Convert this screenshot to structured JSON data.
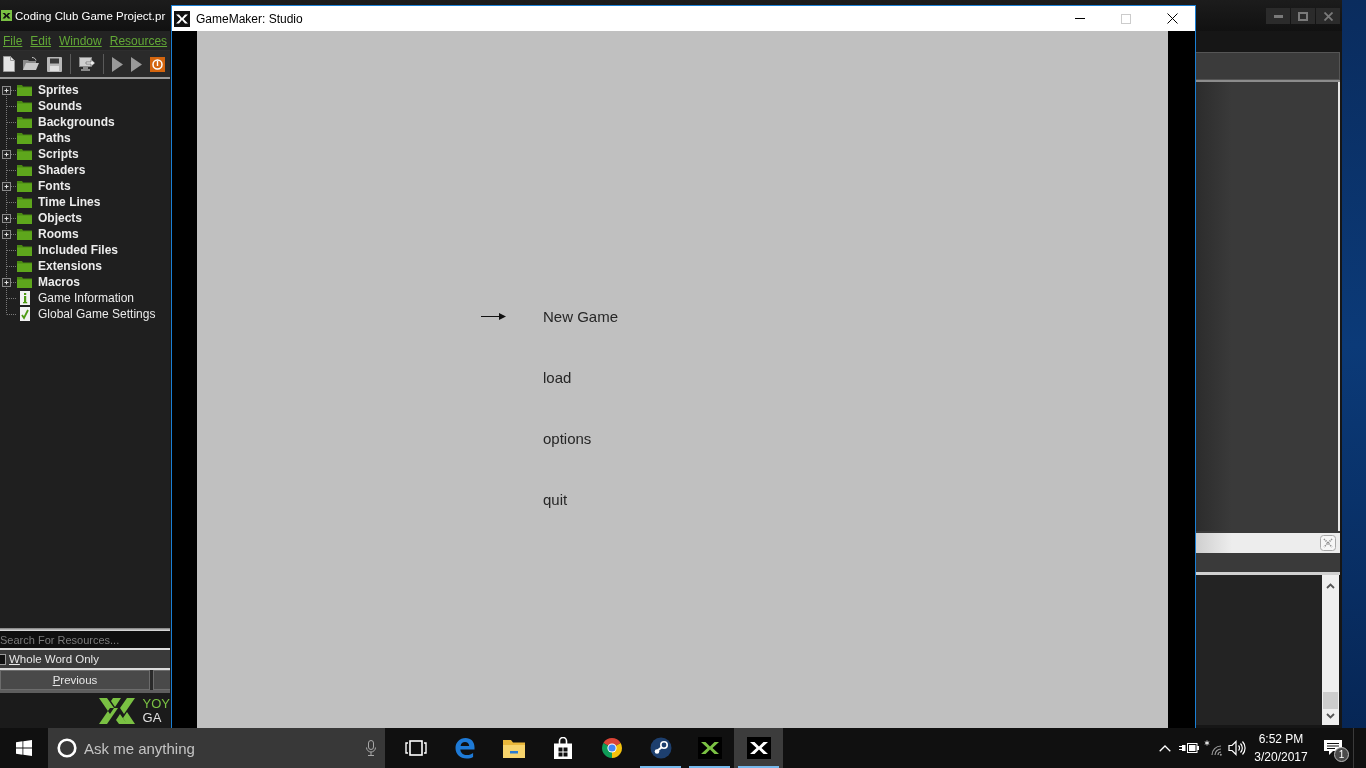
{
  "ide_window": {
    "title": "Coding Club Game Project.pr",
    "menu": [
      "File",
      "Edit",
      "Window",
      "Resources"
    ],
    "resource_tree": [
      {
        "label": "Sprites",
        "kind": "folder",
        "expandable": true
      },
      {
        "label": "Sounds",
        "kind": "folder",
        "expandable": false
      },
      {
        "label": "Backgrounds",
        "kind": "folder",
        "expandable": false
      },
      {
        "label": "Paths",
        "kind": "folder",
        "expandable": false
      },
      {
        "label": "Scripts",
        "kind": "folder",
        "expandable": true
      },
      {
        "label": "Shaders",
        "kind": "folder",
        "expandable": false
      },
      {
        "label": "Fonts",
        "kind": "folder",
        "expandable": true
      },
      {
        "label": "Time Lines",
        "kind": "folder",
        "expandable": false
      },
      {
        "label": "Objects",
        "kind": "folder",
        "expandable": true
      },
      {
        "label": "Rooms",
        "kind": "folder",
        "expandable": true
      },
      {
        "label": "Included Files",
        "kind": "folder",
        "expandable": false
      },
      {
        "label": "Extensions",
        "kind": "folder",
        "expandable": false
      },
      {
        "label": "Macros",
        "kind": "folder",
        "expandable": true
      },
      {
        "label": "Game Information",
        "kind": "info",
        "expandable": false
      },
      {
        "label": "Global Game Settings",
        "kind": "settings",
        "expandable": false
      }
    ],
    "search": {
      "placeholder": "Search For Resources..."
    },
    "whole_word_only": {
      "label": "Whole Word Only",
      "checked": false
    },
    "buttons": [
      "Previous"
    ],
    "logo": {
      "line_1": "YOY",
      "line_2": "GA"
    }
  },
  "game_window": {
    "title": "GameMaker: Studio",
    "maximize_disabled": true,
    "menu": [
      {
        "label": "New Game",
        "selected": true
      },
      {
        "label": "load",
        "selected": false
      },
      {
        "label": "options",
        "selected": false
      },
      {
        "label": "quit",
        "selected": false
      }
    ]
  },
  "taskbar": {
    "search": {
      "placeholder": "Ask me anything"
    },
    "apps": [
      {
        "kind": "task_view",
        "running": false,
        "active": false
      },
      {
        "kind": "e_logo",
        "running": false,
        "active": false
      },
      {
        "kind": "folder",
        "running": false,
        "active": false
      },
      {
        "kind": "bag",
        "running": false,
        "active": false
      },
      {
        "kind": "ring_logo",
        "running": false,
        "active": false
      },
      {
        "kind": "piston_logo",
        "running": true,
        "active": false
      },
      {
        "kind": "gm_ide",
        "running": true,
        "active": false
      },
      {
        "kind": "gm_runner",
        "running": true,
        "active": true
      }
    ],
    "clock": {
      "time": "6:52 PM",
      "date": "3/20/2017"
    },
    "notifications": {
      "count": "1"
    }
  }
}
